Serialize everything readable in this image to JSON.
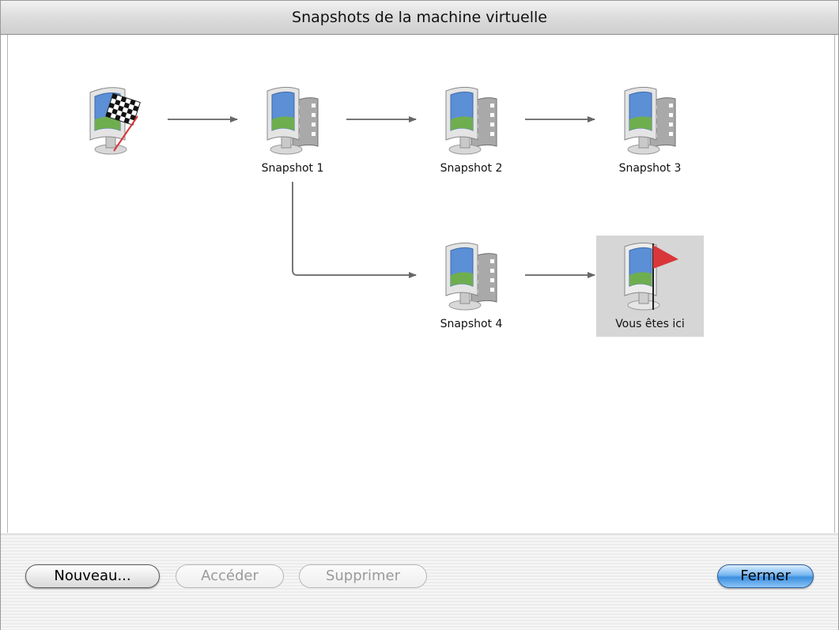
{
  "window": {
    "title": "Snapshots de la machine virtuelle"
  },
  "snapshots": [
    {
      "id": "root",
      "label": "",
      "icon": "vm-start-checkered-flag-icon"
    },
    {
      "id": "s1",
      "label": "Snapshot 1",
      "icon": "vm-snapshot-icon"
    },
    {
      "id": "s2",
      "label": "Snapshot 2",
      "icon": "vm-snapshot-icon"
    },
    {
      "id": "s3",
      "label": "Snapshot 3",
      "icon": "vm-snapshot-icon"
    },
    {
      "id": "s4",
      "label": "Snapshot 4",
      "icon": "vm-snapshot-icon"
    },
    {
      "id": "here",
      "label": "Vous êtes ici",
      "icon": "vm-current-state-red-flag-icon",
      "selected": true
    }
  ],
  "buttons": {
    "new": "Nouveau...",
    "goto": "Accéder",
    "delete": "Supprimer",
    "close": "Fermer"
  },
  "colors": {
    "selection": "#d6d6d6",
    "flag_red": "#d9363a",
    "primary_button": "#3d8fe0"
  }
}
